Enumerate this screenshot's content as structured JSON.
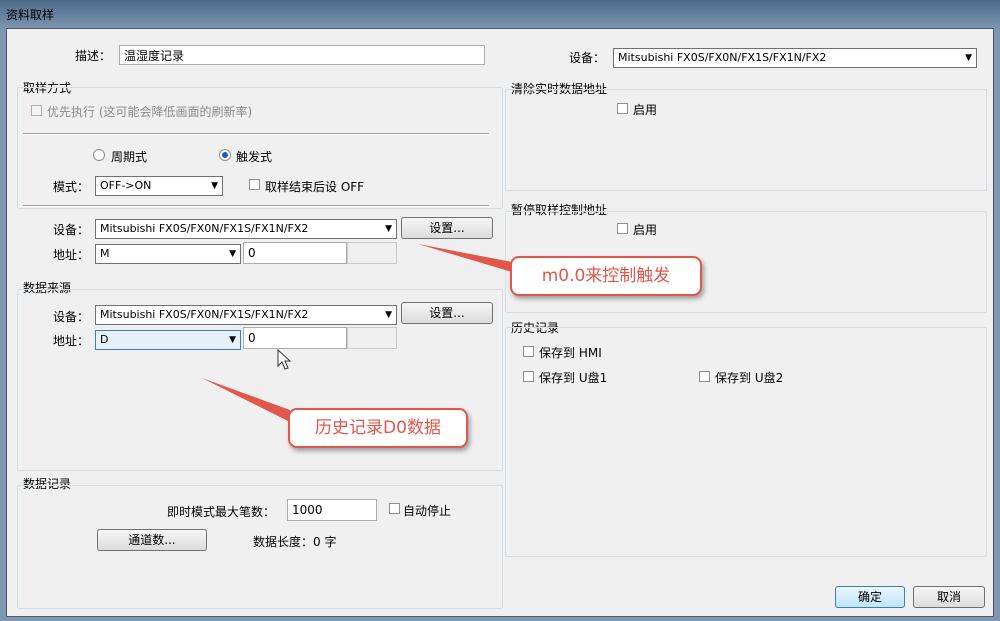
{
  "window": {
    "title": "资料取样"
  },
  "header": {
    "desc_label": "描述：",
    "desc_value": "温湿度记录",
    "device_label": "设备：",
    "device_value": "Mitsubishi FX0S/FX0N/FX1S/FX1N/FX2"
  },
  "sampling": {
    "title": "取样方式",
    "priority_label": "优先执行 (这可能会降低画面的刷新率)",
    "periodic_label": "周期式",
    "trigger_label": "触发式",
    "trigger_selected": true,
    "mode_label": "模式：",
    "mode_value": "OFF->ON",
    "reset_label": "取样结束后设 OFF",
    "device_label": "设备：",
    "device_value": "Mitsubishi FX0S/FX0N/FX1S/FX1N/FX2",
    "settings_label": "设置...",
    "address_label": "地址：",
    "address_type": "M",
    "address_value": "0"
  },
  "source": {
    "title": "数据来源",
    "device_label": "设备：",
    "device_value": "Mitsubishi FX0S/FX0N/FX1S/FX1N/FX2",
    "settings_label": "设置...",
    "address_label": "地址：",
    "address_type": "D",
    "address_value": "0"
  },
  "record": {
    "title": "数据记录",
    "max_label": "即时模式最大笔数：",
    "max_value": "1000",
    "autostop_label": "自动停止",
    "channels_label": "通道数...",
    "length_label": "数据长度：0 字"
  },
  "clear_addr": {
    "title": "清除实时数据地址",
    "enable_label": "启用"
  },
  "pause_addr": {
    "title": "暂停取样控制地址",
    "enable_label": "启用"
  },
  "history": {
    "title": "历史记录",
    "save_hmi": "保存到 HMI",
    "save_u1": "保存到 U盘1",
    "save_u2": "保存到 U盘2"
  },
  "footer": {
    "ok_label": "确定",
    "cancel_label": "取消"
  },
  "annotations": {
    "callout1": "m0.0来控制触发",
    "callout2": "历史记录D0数据"
  },
  "colors": {
    "callout": "#e2574c",
    "frame": "#7f98b3"
  }
}
